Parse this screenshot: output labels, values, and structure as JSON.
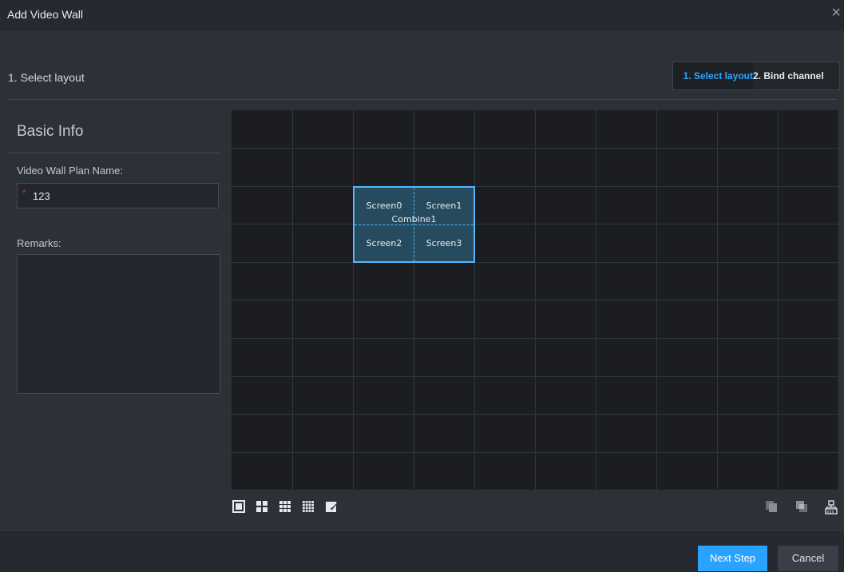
{
  "window": {
    "title": "Add Video Wall",
    "close_glyph": "×"
  },
  "step_header": {
    "current_label": "1. Select layout"
  },
  "steps": [
    {
      "label": "1. Select layout",
      "active": true
    },
    {
      "label": "2. Bind channel",
      "active": false
    }
  ],
  "basic_info": {
    "heading": "Basic Info",
    "plan_name_label": "Video Wall Plan Name:",
    "plan_name_value": "123",
    "required_marker": "*",
    "remarks_label": "Remarks:",
    "remarks_value": ""
  },
  "wall": {
    "rows": 10,
    "cols": 10,
    "combine": {
      "name": "Combine1",
      "screens": [
        "Screen0",
        "Screen1",
        "Screen2",
        "Screen3"
      ]
    }
  },
  "toolbar_left": [
    "single-screen-icon",
    "four-split-icon",
    "nine-split-icon",
    "sixteen-split-icon",
    "custom-edit-icon"
  ],
  "toolbar_right": [
    "copy-icon",
    "merge-icon",
    "network-icon"
  ],
  "footer": {
    "next_label": "Next Step",
    "cancel_label": "Cancel"
  },
  "colors": {
    "accent": "#2aa2ff",
    "selection": "#52b7ff",
    "background": "#2c3037"
  }
}
